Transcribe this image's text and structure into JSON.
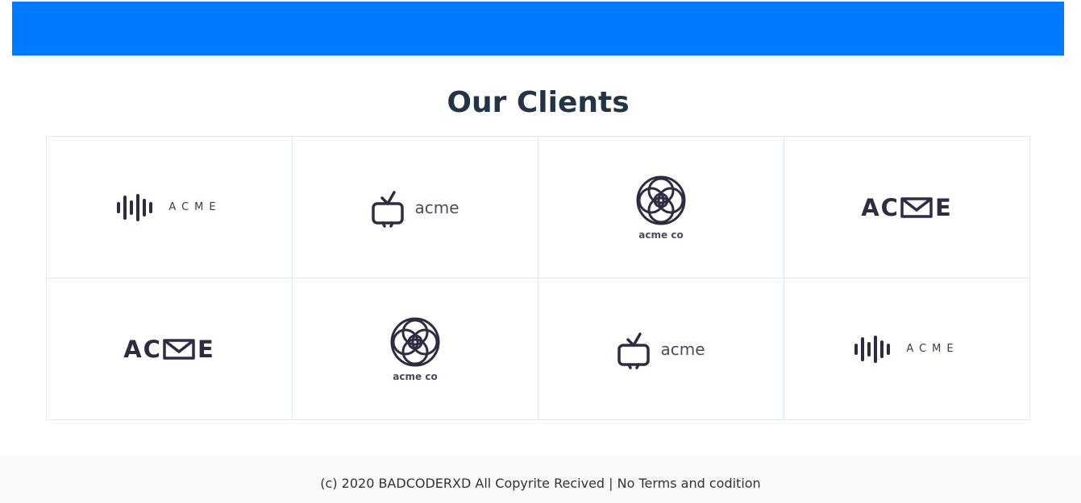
{
  "header": {
    "banner_color": "#007bff"
  },
  "clients": {
    "title": "Our Clients",
    "logos": [
      {
        "type": "bars",
        "icon": "sound-bars-icon",
        "text": "ACME"
      },
      {
        "type": "tv",
        "icon": "tv-icon",
        "text": "acme"
      },
      {
        "type": "flower",
        "icon": "flower-ring-icon",
        "text": "acme co"
      },
      {
        "type": "mail",
        "icon": "envelope-icon",
        "text": "ACME"
      },
      {
        "type": "mail",
        "icon": "envelope-icon",
        "text": "ACME"
      },
      {
        "type": "flower",
        "icon": "flower-ring-icon",
        "text": "acme co"
      },
      {
        "type": "tv",
        "icon": "tv-icon",
        "text": "acme"
      },
      {
        "type": "bars",
        "icon": "sound-bars-icon",
        "text": "ACME"
      }
    ]
  },
  "footer": {
    "text": "(c) 2020 BADCODERXD All Copyrite Recived | No Terms and codition"
  },
  "colors": {
    "logo": "#2e2c42",
    "grid_border": "#d9ebf2",
    "footer_bg": "#f8f9fa",
    "title": "#243447"
  }
}
